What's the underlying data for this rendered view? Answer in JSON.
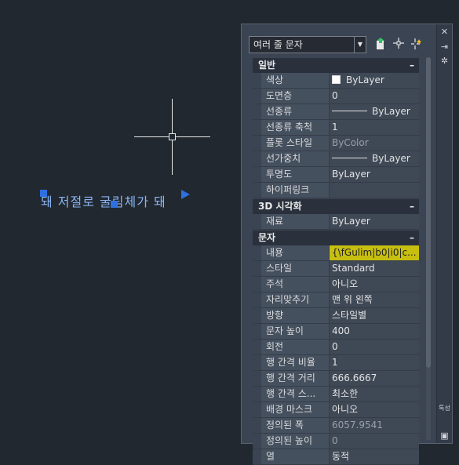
{
  "drawing": {
    "mtext": "돼 저절로 굴림체가 돼"
  },
  "palette": {
    "object_type": "여러 줄 문자",
    "side_label": "특성",
    "categories": [
      {
        "title": "일반",
        "toggle": "–",
        "rows": [
          {
            "name": "색상",
            "value": "ByLayer"
          },
          {
            "name": "도면층",
            "value": "0"
          },
          {
            "name": "선종류",
            "value": "ByLayer"
          },
          {
            "name": "선종류 축척",
            "value": "1"
          },
          {
            "name": "플롯 스타일",
            "value": "ByColor"
          },
          {
            "name": "선가중치",
            "value": "ByLayer"
          },
          {
            "name": "투명도",
            "value": "ByLayer"
          },
          {
            "name": "하이퍼링크",
            "value": ""
          }
        ]
      },
      {
        "title": "3D 시각화",
        "toggle": "–",
        "rows": [
          {
            "name": "재료",
            "value": "ByLayer"
          }
        ]
      },
      {
        "title": "문자",
        "toggle": "–",
        "rows": [
          {
            "name": "내용",
            "value": "{\\fGulim|b0|i0|c..."
          },
          {
            "name": "스타일",
            "value": "Standard"
          },
          {
            "name": "주석",
            "value": "아니오"
          },
          {
            "name": "자리맞추기",
            "value": "맨 위 왼쪽"
          },
          {
            "name": "방향",
            "value": "스타일별"
          },
          {
            "name": "문자 높이",
            "value": "400"
          },
          {
            "name": "회전",
            "value": "0"
          },
          {
            "name": "행 간격 비율",
            "value": "1"
          },
          {
            "name": "행 간격 거리",
            "value": "666.6667"
          },
          {
            "name": "행 간격 스...",
            "value": "최소한"
          },
          {
            "name": "배경 마스크",
            "value": "아니오"
          },
          {
            "name": "정의된 폭",
            "value": "6057.9541"
          },
          {
            "name": "정의된 높이",
            "value": "0"
          },
          {
            "name": "열",
            "value": "동적"
          }
        ]
      }
    ]
  }
}
